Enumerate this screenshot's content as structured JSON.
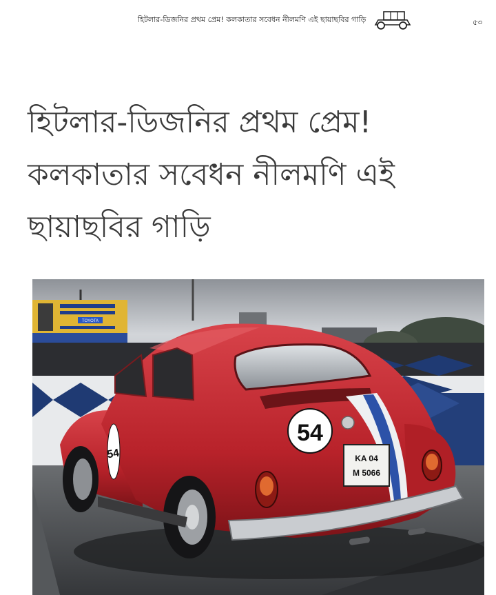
{
  "header": {
    "running_title": "হিটলার-ডিজনির প্রথম প্রেম! কলকাতার সবেধন নীলমণি এই ছায়াছবির গাড়ি",
    "page_number": "৫৩",
    "logo_icon": "vintage-car-icon"
  },
  "article": {
    "headline_lines": [
      "হিটলার-ডিজনির প্রথম প্রেম!",
      "কলকাতার সবেধন নীলমণি এই",
      "ছায়াছবির গাড়ি"
    ]
  },
  "photo": {
    "car_number": "54",
    "side_number": "54",
    "plate_line1": "KA 04",
    "plate_line2": "M 5066",
    "billboard_brand": "TOYOTA",
    "colors": {
      "car_red": "#c0262c",
      "sky": "#c9cdd2",
      "road": "#4a4c4f",
      "wall_blue": "#1f3a73"
    }
  }
}
